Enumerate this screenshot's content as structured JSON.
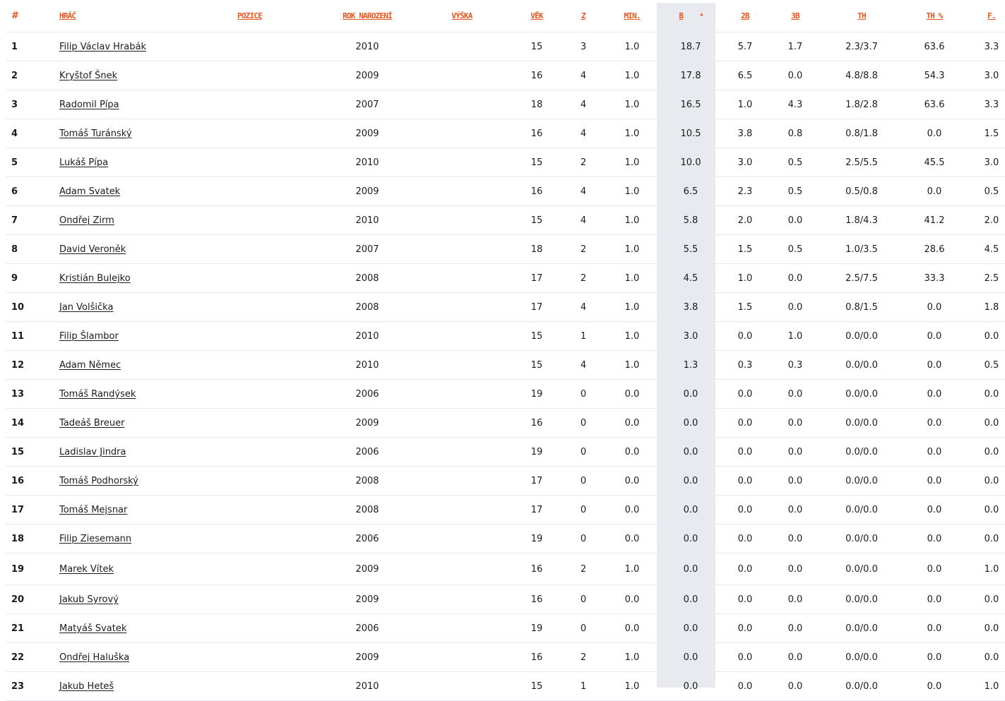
{
  "headers": {
    "num": "#",
    "player": "HRÁČ",
    "position": "POZICE",
    "birth_year": "ROK NAROZENÍ",
    "height": "VÝŠKA",
    "age": "VĚK",
    "games": "Z",
    "minutes": "MIN.",
    "points": "B",
    "two_pt": "2B",
    "three_pt": "3B",
    "free_throws": "TH",
    "free_throw_pct": "TH %",
    "fouls": "F."
  },
  "sort_icon": "sort-up-icon",
  "colors": {
    "header": "#e8561e",
    "sorted_column_bg": "#e8eaf0",
    "row_border": "#e7e9ee"
  },
  "rows": [
    {
      "num": "1",
      "name": "Filip Václav Hrabák",
      "position": "",
      "year": "2010",
      "height": "",
      "age": "15",
      "games": "3",
      "min": "1.0",
      "pts": "18.7",
      "two": "5.7",
      "three": "1.7",
      "th": "2.3/3.7",
      "thp": "63.6",
      "f": "3.3"
    },
    {
      "num": "2",
      "name": "Kryštof Šnek",
      "position": "",
      "year": "2009",
      "height": "",
      "age": "16",
      "games": "4",
      "min": "1.0",
      "pts": "17.8",
      "two": "6.5",
      "three": "0.0",
      "th": "4.8/8.8",
      "thp": "54.3",
      "f": "3.0"
    },
    {
      "num": "3",
      "name": "Radomil Pípa",
      "position": "",
      "year": "2007",
      "height": "",
      "age": "18",
      "games": "4",
      "min": "1.0",
      "pts": "16.5",
      "two": "1.0",
      "three": "4.3",
      "th": "1.8/2.8",
      "thp": "63.6",
      "f": "3.3"
    },
    {
      "num": "4",
      "name": "Tomáš Turánský",
      "position": "",
      "year": "2009",
      "height": "",
      "age": "16",
      "games": "4",
      "min": "1.0",
      "pts": "10.5",
      "two": "3.8",
      "three": "0.8",
      "th": "0.8/1.8",
      "thp": "0.0",
      "f": "1.5"
    },
    {
      "num": "5",
      "name": "Lukáš Pípa",
      "position": "",
      "year": "2010",
      "height": "",
      "age": "15",
      "games": "2",
      "min": "1.0",
      "pts": "10.0",
      "two": "3.0",
      "three": "0.5",
      "th": "2.5/5.5",
      "thp": "45.5",
      "f": "3.0"
    },
    {
      "num": "6",
      "name": "Adam Svatek",
      "position": "",
      "year": "2009",
      "height": "",
      "age": "16",
      "games": "4",
      "min": "1.0",
      "pts": "6.5",
      "two": "2.3",
      "three": "0.5",
      "th": "0.5/0.8",
      "thp": "0.0",
      "f": "0.5"
    },
    {
      "num": "7",
      "name": "Ondřej Zirm",
      "position": "",
      "year": "2010",
      "height": "",
      "age": "15",
      "games": "4",
      "min": "1.0",
      "pts": "5.8",
      "two": "2.0",
      "three": "0.0",
      "th": "1.8/4.3",
      "thp": "41.2",
      "f": "2.0"
    },
    {
      "num": "8",
      "name": "David Veroněk",
      "position": "",
      "year": "2007",
      "height": "",
      "age": "18",
      "games": "2",
      "min": "1.0",
      "pts": "5.5",
      "two": "1.5",
      "three": "0.5",
      "th": "1.0/3.5",
      "thp": "28.6",
      "f": "4.5"
    },
    {
      "num": "9",
      "name": "Kristián Bulejko",
      "position": "",
      "year": "2008",
      "height": "",
      "age": "17",
      "games": "2",
      "min": "1.0",
      "pts": "4.5",
      "two": "1.0",
      "three": "0.0",
      "th": "2.5/7.5",
      "thp": "33.3",
      "f": "2.5"
    },
    {
      "num": "10",
      "name": "Jan Volšička",
      "position": "",
      "year": "2008",
      "height": "",
      "age": "17",
      "games": "4",
      "min": "1.0",
      "pts": "3.8",
      "two": "1.5",
      "three": "0.0",
      "th": "0.8/1.5",
      "thp": "0.0",
      "f": "1.8"
    },
    {
      "num": "11",
      "name": "Filip Šlambor",
      "position": "",
      "year": "2010",
      "height": "",
      "age": "15",
      "games": "1",
      "min": "1.0",
      "pts": "3.0",
      "two": "0.0",
      "three": "1.0",
      "th": "0.0/0.0",
      "thp": "0.0",
      "f": "0.0"
    },
    {
      "num": "12",
      "name": "Adam Němec",
      "position": "",
      "year": "2010",
      "height": "",
      "age": "15",
      "games": "4",
      "min": "1.0",
      "pts": "1.3",
      "two": "0.3",
      "three": "0.3",
      "th": "0.0/0.0",
      "thp": "0.0",
      "f": "0.5"
    },
    {
      "num": "13",
      "name": "Tomáš Randýsek",
      "position": "",
      "year": "2006",
      "height": "",
      "age": "19",
      "games": "0",
      "min": "0.0",
      "pts": "0.0",
      "two": "0.0",
      "three": "0.0",
      "th": "0.0/0.0",
      "thp": "0.0",
      "f": "0.0"
    },
    {
      "num": "14",
      "name": "Tadeáš Breuer",
      "position": "",
      "year": "2009",
      "height": "",
      "age": "16",
      "games": "0",
      "min": "0.0",
      "pts": "0.0",
      "two": "0.0",
      "three": "0.0",
      "th": "0.0/0.0",
      "thp": "0.0",
      "f": "0.0"
    },
    {
      "num": "15",
      "name": "Ladislav Jindra",
      "position": "",
      "year": "2006",
      "height": "",
      "age": "19",
      "games": "0",
      "min": "0.0",
      "pts": "0.0",
      "two": "0.0",
      "three": "0.0",
      "th": "0.0/0.0",
      "thp": "0.0",
      "f": "0.0"
    },
    {
      "num": "16",
      "name": "Tomáš Podhorský",
      "position": "",
      "year": "2008",
      "height": "",
      "age": "17",
      "games": "0",
      "min": "0.0",
      "pts": "0.0",
      "two": "0.0",
      "three": "0.0",
      "th": "0.0/0.0",
      "thp": "0.0",
      "f": "0.0"
    },
    {
      "num": "17",
      "name": "Tomáš Mejsnar",
      "position": "",
      "year": "2008",
      "height": "",
      "age": "17",
      "games": "0",
      "min": "0.0",
      "pts": "0.0",
      "two": "0.0",
      "three": "0.0",
      "th": "0.0/0.0",
      "thp": "0.0",
      "f": "0.0"
    },
    {
      "num": "18",
      "name": "Filip Ziesemann",
      "position": "",
      "year": "2006",
      "height": "",
      "age": "19",
      "games": "0",
      "min": "0.0",
      "pts": "0.0",
      "two": "0.0",
      "three": "0.0",
      "th": "0.0/0.0",
      "thp": "0.0",
      "f": "0.0"
    },
    {
      "num": "19",
      "name": "Marek Vítek",
      "position": "",
      "year": "2009",
      "height": "",
      "age": "16",
      "games": "2",
      "min": "1.0",
      "pts": "0.0",
      "two": "0.0",
      "three": "0.0",
      "th": "0.0/0.0",
      "thp": "0.0",
      "f": "1.0"
    },
    {
      "num": "20",
      "name": "Jakub Syrový",
      "position": "",
      "year": "2009",
      "height": "",
      "age": "16",
      "games": "0",
      "min": "0.0",
      "pts": "0.0",
      "two": "0.0",
      "three": "0.0",
      "th": "0.0/0.0",
      "thp": "0.0",
      "f": "0.0"
    },
    {
      "num": "21",
      "name": "Matyáš Svatek",
      "position": "",
      "year": "2006",
      "height": "",
      "age": "19",
      "games": "0",
      "min": "0.0",
      "pts": "0.0",
      "two": "0.0",
      "three": "0.0",
      "th": "0.0/0.0",
      "thp": "0.0",
      "f": "0.0"
    },
    {
      "num": "22",
      "name": "Ondřej Haluška",
      "position": "",
      "year": "2009",
      "height": "",
      "age": "16",
      "games": "2",
      "min": "1.0",
      "pts": "0.0",
      "two": "0.0",
      "three": "0.0",
      "th": "0.0/0.0",
      "thp": "0.0",
      "f": "0.0"
    },
    {
      "num": "23",
      "name": "Jakub Heteš",
      "position": "",
      "year": "2010",
      "height": "",
      "age": "15",
      "games": "1",
      "min": "1.0",
      "pts": "0.0",
      "two": "0.0",
      "three": "0.0",
      "th": "0.0/0.0",
      "thp": "0.0",
      "f": "1.0"
    }
  ]
}
